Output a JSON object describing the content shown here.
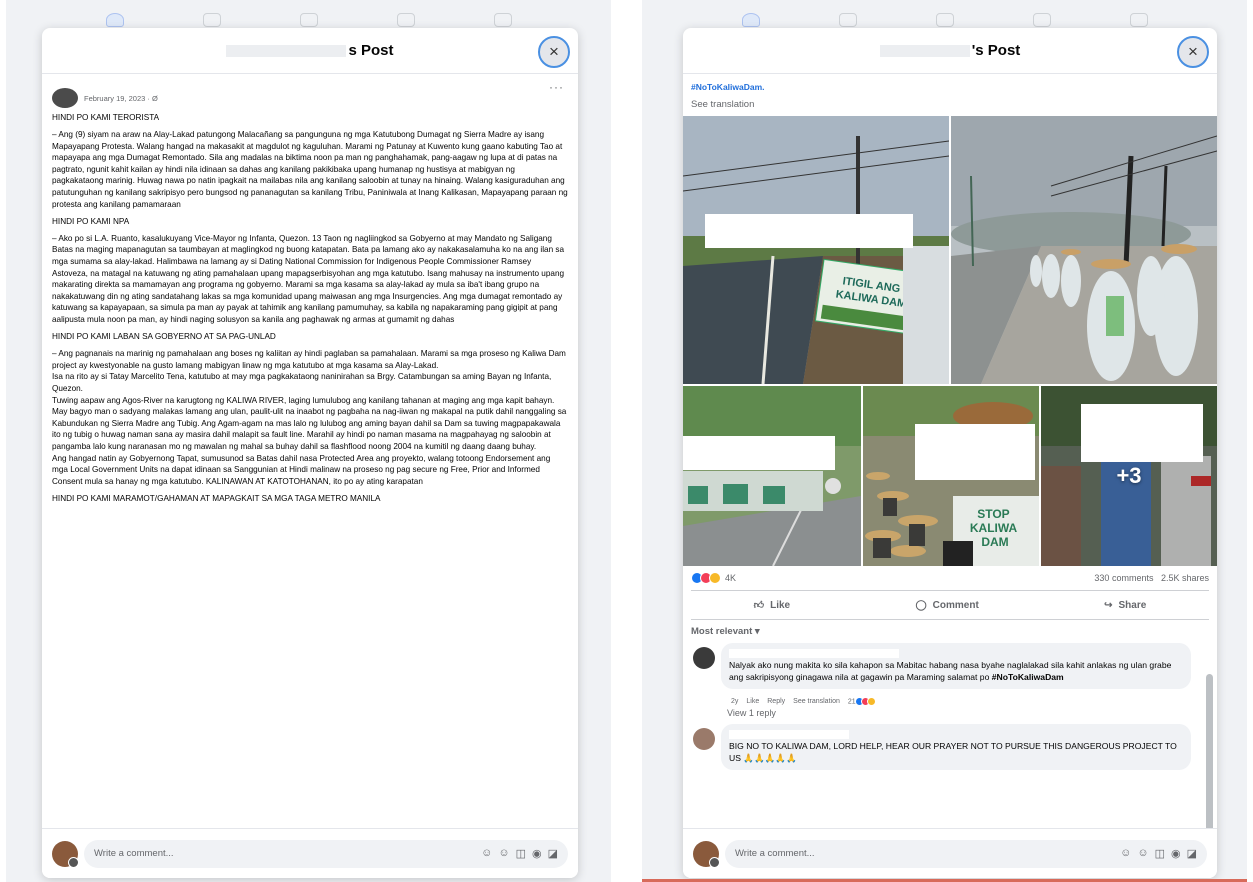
{
  "left": {
    "title_suffix": "s Post",
    "close_icon": "×",
    "more_icon": "···",
    "post_date": "February 19, 2023 · Ø",
    "paragraphs": [
      "HINDI PO KAMI TERORISTA",
      "– Ang (9) siyam na araw na Alay-Lakad patungong Malacañang sa pangunguna ng mga Katutubong Dumagat ng Sierra Madre ay isang Mapayapang Protesta. Walang hangad na makasakit at magdulot ng kaguluhan. Marami ng Patunay at Kuwento kung gaano kabuting Tao at mapayapa ang mga Dumagat Remontado. Sila ang madalas na biktima noon pa man ng panghahamak, pang-aagaw ng lupa at di patas na pagtrato, ngunit kahit kailan ay hindi nila idinaan sa dahas ang kanilang pakikibaka upang humanap ng hustisya at mabigyan ng pagkakataong marinig. Huwag nawa po natin ipagkait na mailabas nila ang kanilang saloobin at tunay na hinaing. Walang kasiguraduhan ang patutunguhan ng kanilang sakripisyo pero bungsod ng pananagutan sa kanilang Tribu, Paniniwala at Inang Kalikasan, Mapayapang paraan ng protesta ang kanilang pamamaraan",
      "HINDI PO KAMI NPA",
      "– Ako po si L.A. Ruanto, kasalukuyang Vice-Mayor ng Infanta, Quezon. 13 Taon ng nagliingkod sa Gobyerno at may Mandato ng Saligang Batas na maging mapanagutan sa taumbayan at maglingkod ng buong katapatan. Bata pa lamang ako ay nakakasalamuha ko na ang ilan sa mga sumama sa alay-lakad. Halimbawa na lamang ay si Dating National Commission for Indigenous People Commissioner Ramsey Astoveza, na matagal na katuwang ng ating pamahalaan upang mapagserbisyohan ang mga katutubo. Isang mahusay na instrumento upang makarating direkta sa mamamayan ang programa ng gobyerno. Marami sa mga kasama sa alay-lakad ay mula sa iba't ibang grupo na nakakatuwang din ng ating sandatahang lakas sa mga komunidad upang maiwasan ang mga Insurgencies. Ang mga dumagat remontado ay katuwang sa kapayapaan, sa simula pa man ay payak at tahimik ang kanilang pamumuhay, sa kabila ng napakaraming pang gigipit at pang aalipusta mula noon pa man, ay hindi naging solusyon sa kanila ang paghawak ng armas at gumamit ng dahas",
      "HINDI PO KAMI LABAN SA GOBYERNO AT SA PAG-UNLAD",
      "– Ang pagnanais na marinig ng pamahalaan ang boses ng kaliitan ay hindi paglaban sa pamahalaan. Marami sa mga proseso ng Kaliwa Dam project ay kwestyonable na gusto lamang mabigyan linaw ng mga katutubo at mga kasama sa Alay-Lakad.\nIsa na rito ay si Tatay Marcelito Tena, katutubo at may mga pagkakataong naninirahan sa Brgy. Catambungan sa aming Bayan ng Infanta, Quezon.\nTuwing aapaw ang Agos-River na karugtong ng KALIWA RIVER, laging lumulubog ang kanilang tahanan at maging ang mga kapit bahayn. May bagyo man o sadyang malakas lamang ang ulan, paulit-ulit na inaabot ng pagbaha na nag-iiwan ng makapal na putik dahil nanggaling sa Kabundukan ng Sierra Madre ang Tubig. Ang Agam-agam na mas lalo ng lulubog ang aming bayan dahil sa Dam sa tuwing magpapakawala ito ng tubig o huwag naman sana ay masira dahil malapit sa fault line. Marahil ay hindi po naman masama na magpahayag ng saloobin at pangamba lalo kung naranasan mo ng mawalan ng mahal sa buhay dahil sa flashflood noong 2004 na kumitil ng daang daang buhay.\nAng hangad natin ay Gobyernong Tapat, sumusunod sa Batas dahil nasa Protected Area ang proyekto, walang totoong Endorsement ang mga Local Government Units na dapat idinaan sa Sanggunian at Hindi malinaw na proseso ng pag secure ng Free, Prior and Informed Consent mula sa hanay ng mga katutubo. KALINAWAN AT KATOTOHANAN, ito po ay ating karapatan",
      "HINDI PO KAMI MARAMOT/GAHAMAN AT MAPAGKAIT SA MGA TAGA METRO MANILA"
    ],
    "comment_placeholder": "Write a comment..."
  },
  "right": {
    "title_suffix": "'s Post",
    "close_icon": "×",
    "hashtag": "#NoToKaliwaDam.",
    "see_translation": "See translation",
    "more_photos": "+3",
    "reaction_count": "4K",
    "comment_count": "330 comments",
    "share_count": "2.5K shares",
    "actions": {
      "like": "Like",
      "comment": "Comment",
      "share": "Share"
    },
    "sort_label": "Most relevant ▾",
    "comments": [
      {
        "text": "Nalyak ako nung makita ko sila kahapon sa Mabitac habang nasa byahe naglalakad sila kahit anlakas ng ulan grabe ang sakripisyong ginagawa nila at gagawin pa Maraming salamat po",
        "hashtag": "#NoToKaliwaDam",
        "age": "2y",
        "like": "Like",
        "reply": "Reply",
        "translate": "See translation",
        "reactions": "21",
        "view_replies": "View 1 reply"
      },
      {
        "text": "BIG NO TO KALIWA DAM, LORD HELP, HEAR OUR PRAYER NOT TO PURSUE THIS DANGEROUS PROJECT TO US 🙏🙏🙏🙏🙏"
      }
    ],
    "comment_placeholder": "Write a comment..."
  },
  "photo_signs": {
    "sign1": "ITIGIL ANG KALIWA DAM",
    "sign2": "STOP KALIWA DAM"
  },
  "colors": {
    "link_blue": "#216fdb",
    "close_ring": "#4a90e2",
    "like_blue": "#1877f2",
    "love_red": "#f33e58",
    "haha_yellow": "#f7b928"
  }
}
